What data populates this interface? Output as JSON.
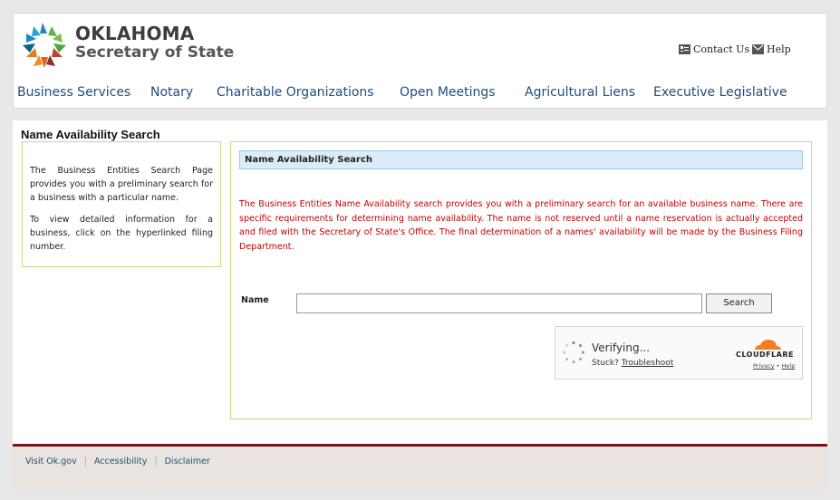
{
  "header": {
    "brand_line1": "OKLAHOMA",
    "brand_line2": "Secretary of State",
    "utility": [
      {
        "label": "Contact Us",
        "icon": "contact-icon"
      },
      {
        "label": "Help",
        "icon": "help-icon"
      }
    ]
  },
  "nav": {
    "items": [
      {
        "label": "Business Services"
      },
      {
        "label": "Notary"
      },
      {
        "label": "Charitable Organizations"
      },
      {
        "label": "Open Meetings"
      },
      {
        "label": "Agricultural Liens"
      },
      {
        "label": "Executive Legislative"
      }
    ]
  },
  "page": {
    "title": "Name Availability Search"
  },
  "sidebar": {
    "para1": "The Business Entities Search Page provides you with a preliminary search for a business with a particular name.",
    "para2": "To view detailed information for a business, click on the hyperlinked filing number."
  },
  "main": {
    "panel_title": "Name Availability Search",
    "notice": "The Business Entities Name Availability search provides you with a preliminary search for an available business name. There are specific requirements for determining name availability. The name is not reserved until a name reservation is actually accepted and filed with the Secretary of State's Office. The final determination of a names' availability will be made by the Business Filing Department.",
    "name_label": "Name",
    "name_value": "",
    "search_label": "Search"
  },
  "turnstile": {
    "status": "Verifying...",
    "stuck_text": "Stuck?",
    "troubleshoot": "Troubleshoot",
    "brand": "CLOUDFLARE",
    "privacy": "Privacy",
    "link_sep": "•",
    "help": "Help"
  },
  "footer": {
    "links": [
      {
        "label": "Visit Ok.gov"
      },
      {
        "label": "Accessibility"
      },
      {
        "label": "Disclaimer"
      }
    ]
  },
  "colors": {
    "nav_text": "#1f4e79",
    "notice_text": "#c00000",
    "panel_header_bg": "#d9ecf7",
    "box_border": "#d9cf88",
    "footer_border": "#7a1019",
    "footer_bg": "#e9e4df",
    "cloudflare_orange": "#f38020"
  }
}
